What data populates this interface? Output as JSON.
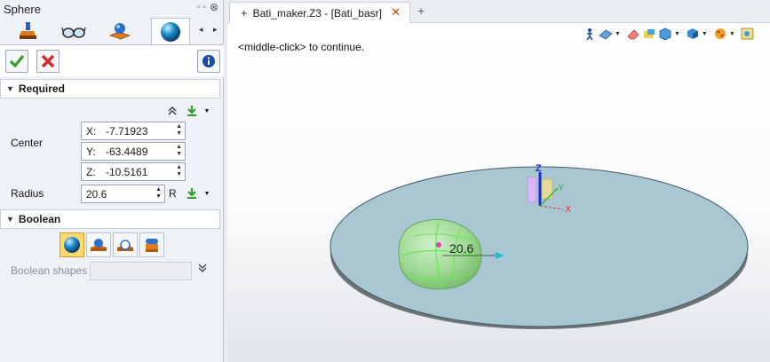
{
  "panel": {
    "title": "Sphere",
    "pin_glyph": "▫ ▫",
    "close_glyph": "⊗",
    "tabs": [
      {
        "name": "tab-feature",
        "icon": "stamp-icon"
      },
      {
        "name": "tab-view",
        "icon": "glasses-icon"
      },
      {
        "name": "tab-shapes",
        "icon": "shapes-icon"
      },
      {
        "name": "tab-sphere",
        "icon": "sphere-icon",
        "active": true
      }
    ],
    "tab_left_arrow": "◂",
    "tab_right_arrow": "▸",
    "ok_icon": "check-icon",
    "cancel_icon": "x-icon",
    "info_icon": "info-icon"
  },
  "required": {
    "header": "Required",
    "center_label": "Center",
    "x_axis": "X:",
    "x_value": "-7.71923",
    "y_axis": "Y:",
    "y_value": "-63.4489",
    "z_axis": "Z:",
    "z_value": "-10.5161",
    "radius_label": "Radius",
    "radius_value": "20.6",
    "radius_suffix": "R"
  },
  "boolean": {
    "header": "Boolean",
    "options": [
      {
        "name": "boolean-base",
        "selected": true
      },
      {
        "name": "boolean-add",
        "selected": false
      },
      {
        "name": "boolean-remove",
        "selected": false
      },
      {
        "name": "boolean-intersect",
        "selected": false
      }
    ],
    "shapes_label": "Boolean shapes",
    "shapes_value": ""
  },
  "document": {
    "tab_label": "Bati_maker.Z3 - [Bati_basr]",
    "tab_plus": "+",
    "tab_close": "✕",
    "new_tab": "+"
  },
  "viewport": {
    "prompt": "<middle-click> to continue.",
    "dimension_label": "20.6",
    "triad_x": "X",
    "triad_y": "Y",
    "triad_z": "Z"
  },
  "colors": {
    "accent_green": "#2f9e2f",
    "cancel_red": "#d02a2a",
    "disk_fill": "#a9c6d3",
    "sphere_fill": "#a8e09a",
    "triad_blue": "#1a2fd0"
  }
}
